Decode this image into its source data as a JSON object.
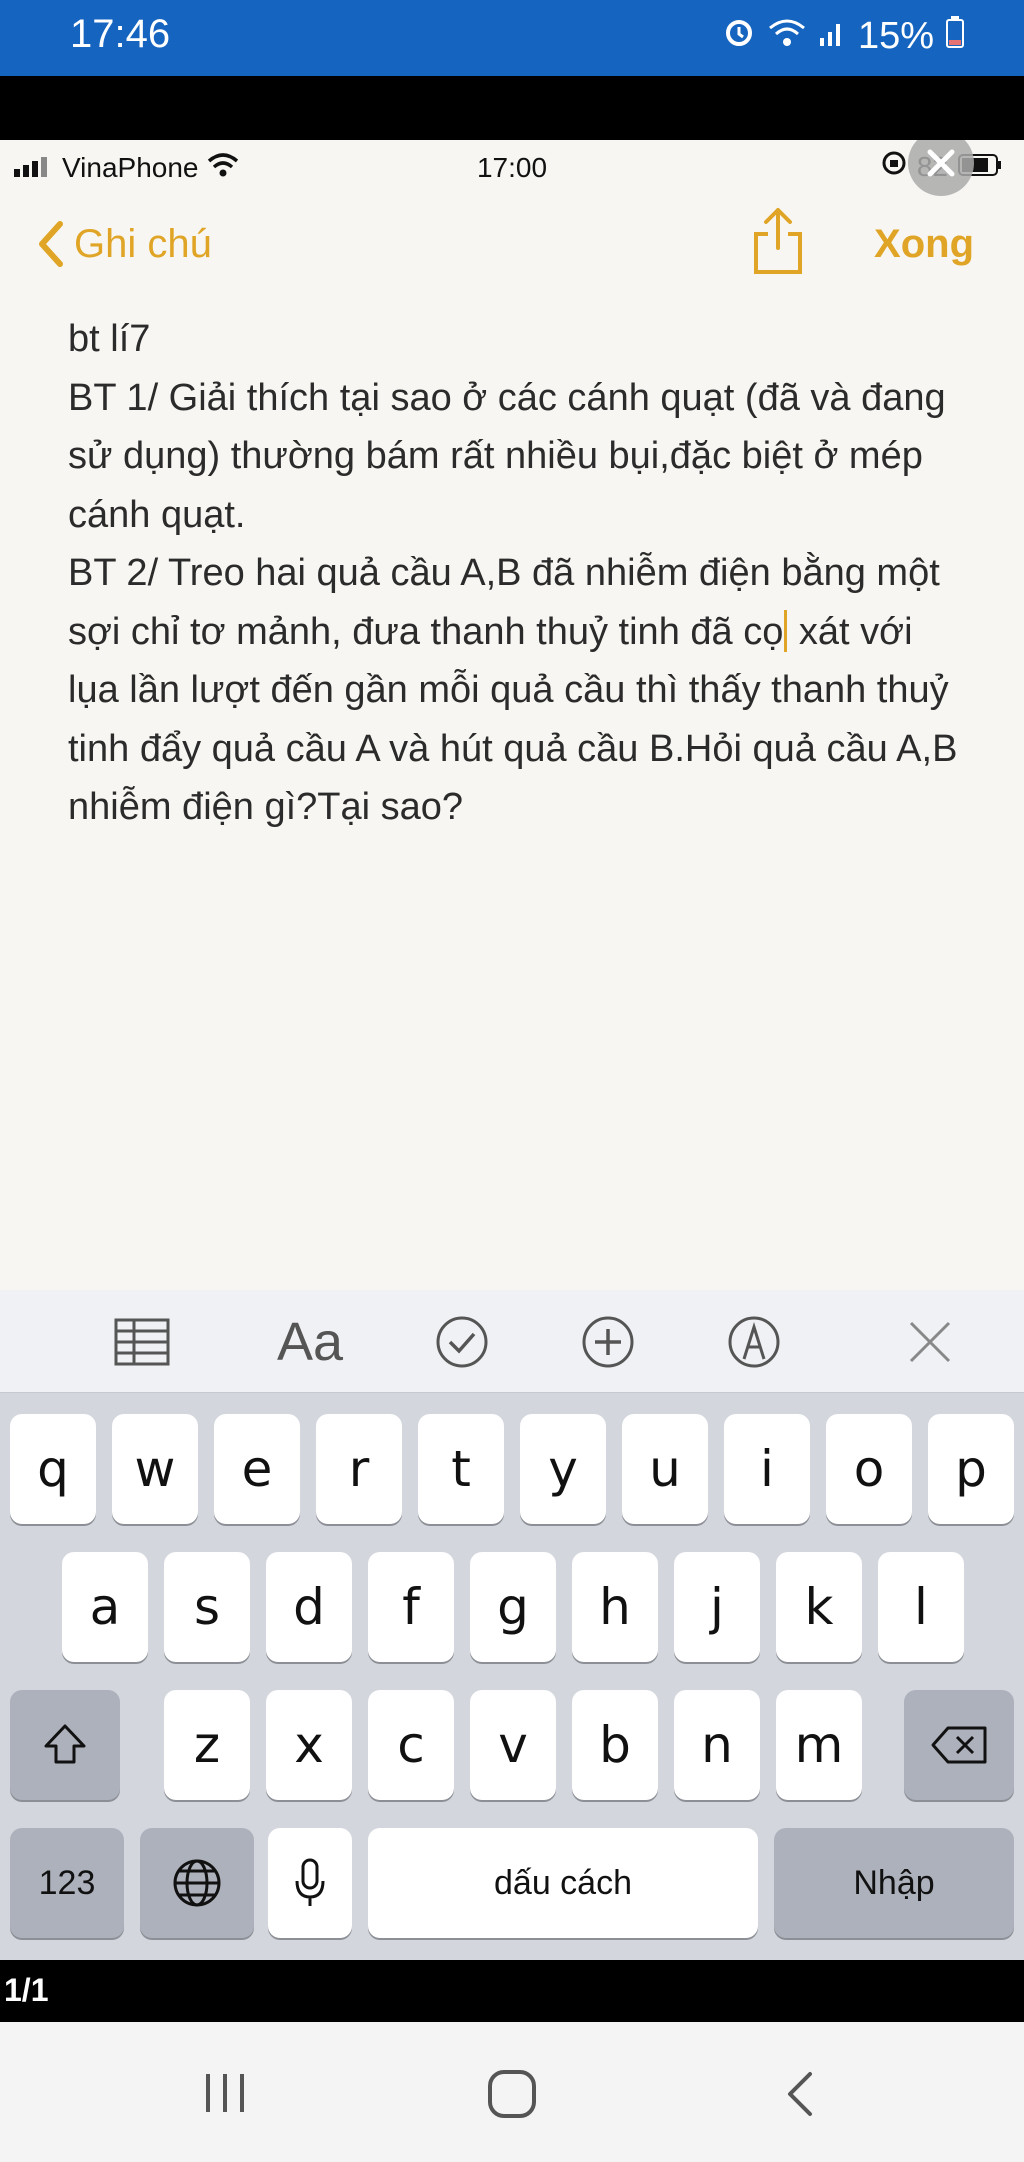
{
  "android_status": {
    "time": "17:46",
    "battery": "15%"
  },
  "ios_status": {
    "carrier": "VinaPhone",
    "time": "17:00",
    "battery": "82"
  },
  "nav": {
    "back_label": "Ghi chú",
    "done_label": "Xong"
  },
  "note": {
    "lines": [
      "bt lí7",
      "BT 1/ Giải thích tại sao ở các cánh quạt (đã và đang sử dụng) thường bám rất nhiều bụi,đặc biệt ở mép cánh quạt.",
      "BT 2/ Treo hai quả cầu A,B đã nhiễm điện bằng một sợi chỉ tơ mảnh, đưa thanh thuỷ tinh đã cọ",
      " xát với lụa lần lượt đến gần mỗi quả cầu thì thấy thanh thuỷ tinh đẩy quả cầu A và hút quả cầu B.Hỏi quả cầu A,B nhiễm điện gì?Tại sao?"
    ]
  },
  "keyboard": {
    "toolbar_icons": [
      "table-icon",
      "text-format-icon",
      "checklist-icon",
      "add-icon",
      "markup-icon",
      "close-icon"
    ],
    "toolbar_aa": "Aa",
    "row1": [
      "q",
      "w",
      "e",
      "r",
      "t",
      "y",
      "u",
      "i",
      "o",
      "p"
    ],
    "row2": [
      "a",
      "s",
      "d",
      "f",
      "g",
      "h",
      "j",
      "k",
      "l"
    ],
    "row3": [
      "z",
      "x",
      "c",
      "v",
      "b",
      "n",
      "m"
    ],
    "numbers_label": "123",
    "space_label": "dấu cách",
    "return_label": "Nhập"
  },
  "page_indicator": "1/1"
}
